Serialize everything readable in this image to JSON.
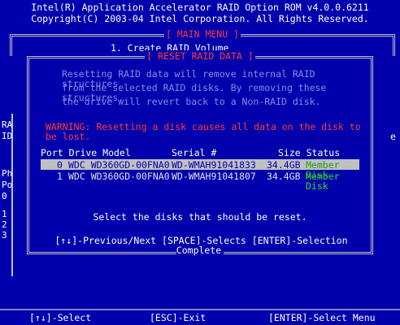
{
  "header": {
    "line1": "Intel(R) Application Accelerator RAID Option ROM v4.0.0.6211",
    "line2": "Copyright(C) 2003-04 Intel Corporation.  All Rights Reserved."
  },
  "main_menu": {
    "title": "[ MAIN MENU ]",
    "item1": "1.  Create RAID Volume"
  },
  "background_fragments": {
    "left": [
      "RA",
      "ID",
      "",
      "Ph",
      "Po",
      "0",
      "1",
      "2",
      "3"
    ],
    "right": "e"
  },
  "dialog": {
    "title": "[ RESET RAID DATA ]",
    "description": [
      "Resetting RAID data will remove internal RAID structures",
      "from the selected RAID disks. By removing these structures,",
      "the drive will revert back to a Non-RAID disk."
    ],
    "warning_label": "WARNING:",
    "warning_text": " Resetting a disk causes all data on the disk to be lost.",
    "columns": {
      "port_drive_model": "Port Drive Model",
      "serial": "Serial #",
      "size_status": "Size Status"
    },
    "disks": [
      {
        "port": "0",
        "model": "WDC WD360GD-00FNA0",
        "serial": "WD-WMAH91041833",
        "size": "34.4GB",
        "status": "Member Disk",
        "selected": true
      },
      {
        "port": "1",
        "model": "WDC WD360GD-00FNA0",
        "serial": "WD-WMAH91041807",
        "size": "34.4GB",
        "status": "Member Disk",
        "selected": false
      }
    ],
    "prompt": "Select the disks that should be reset.",
    "help": "[↑↓]-Previous/Next  [SPACE]-Selects  [ENTER]-Selection Complete"
  },
  "footer": {
    "select": "[↑↓]-Select",
    "exit": "[ESC]-Exit",
    "enter": "[ENTER]-Select Menu"
  },
  "colors": {
    "background": "#0000ac",
    "title_red": "#ff3a3a",
    "member_green": "#2fe02f",
    "highlight": "#c0c0c0"
  }
}
